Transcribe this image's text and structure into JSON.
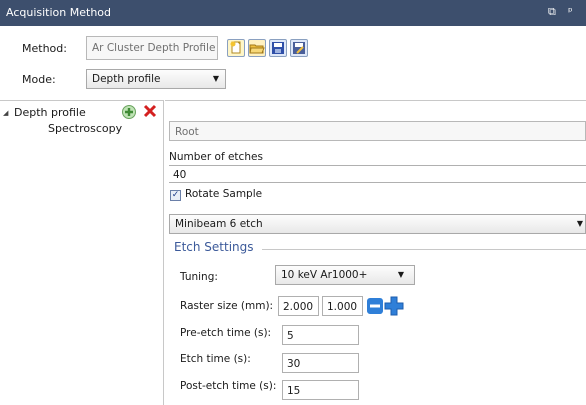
{
  "window": {
    "title": "Acquisition Method",
    "restore_glyph": "⧉",
    "pin_glyph": "ᵖ"
  },
  "method": {
    "label": "Method:",
    "value": "Ar Cluster Depth Profile",
    "toolbar_icons": [
      "new-document-icon",
      "open-folder-icon",
      "save-icon",
      "save-as-icon"
    ]
  },
  "mode": {
    "label": "Mode:",
    "value": "Depth profile"
  },
  "tree": {
    "root_label": "Depth profile",
    "child_label": "Spectroscopy",
    "expand_glyph": "◢"
  },
  "detail": {
    "root_value": "Root",
    "etches_label": "Number of etches",
    "etches_value": "40",
    "rotate_label": "Rotate Sample",
    "rotate_checked": true,
    "etch_source_value": "Minibeam 6 etch"
  },
  "etch_settings": {
    "title": "Etch Settings",
    "tuning_label": "Tuning:",
    "tuning_value": "10 keV Ar1000+",
    "raster_label": "Raster size (mm):",
    "raster_x": "2.000",
    "raster_y": "1.000",
    "pre_etch_label": "Pre-etch time (s):",
    "pre_etch_value": "5",
    "etch_time_label": "Etch time (s):",
    "etch_time_value": "30",
    "post_etch_label": "Post-etch time (s):",
    "post_etch_value": "15"
  },
  "colors": {
    "titlebar": "#3d4f6d",
    "section_title": "#3c5a9a",
    "accent_blue": "#2f7fd8",
    "delete_red": "#d42020"
  }
}
